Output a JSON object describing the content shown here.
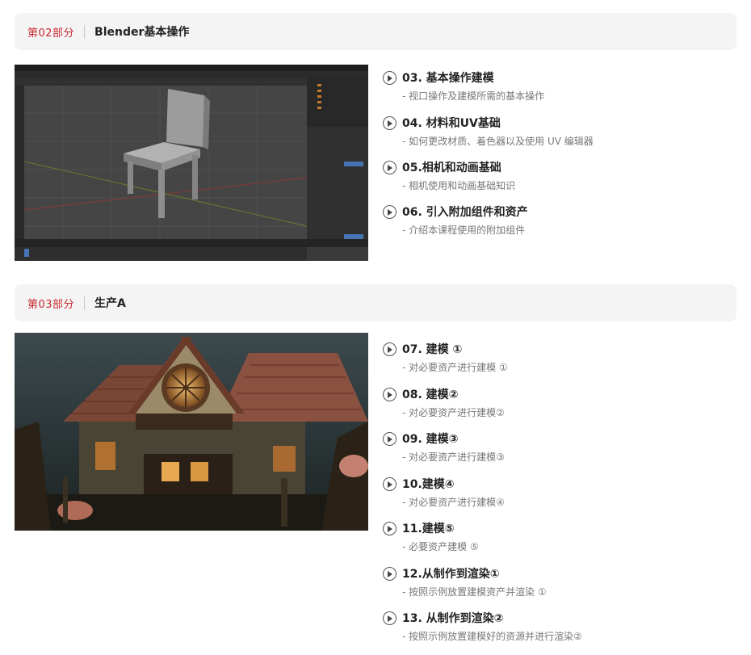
{
  "sections": [
    {
      "part": "第02部分",
      "title": "Blender基本操作",
      "lessons": [
        {
          "title": "03. 基本操作建模",
          "sub": "- 视口操作及建模所需的基本操作"
        },
        {
          "title": "04. 材料和UV基础",
          "sub": "- 如何更改材质、着色器以及使用 UV 编辑器"
        },
        {
          "title": "05.相机和动画基础",
          "sub": "- 相机使用和动画基础知识"
        },
        {
          "title": "06. 引入附加组件和资产",
          "sub": "- 介绍本课程使用的附加组件"
        }
      ]
    },
    {
      "part": "第03部分",
      "title": "生产A",
      "lessons": [
        {
          "title": "07. 建模 ①",
          "sub": "- 对必要资产进行建模 ①"
        },
        {
          "title": "08. 建模②",
          "sub": "- 对必要资产进行建模②"
        },
        {
          "title": "09. 建模③",
          "sub": "- 对必要资产进行建模③"
        },
        {
          "title": "10.建模④",
          "sub": "- 对必要资产进行建模④"
        },
        {
          "title": "11.建模⑤",
          "sub": "- 必要资产建模 ⑤"
        },
        {
          "title": "12.从制作到渲染①",
          "sub": "- 按照示例放置建模资产并渲染 ①"
        },
        {
          "title": "13. 从制作到渲染②",
          "sub": "- 按照示例放置建模好的资源并进行渲染②"
        }
      ]
    }
  ],
  "colors": {
    "accent": "#c8272f",
    "header_bg": "#f4f4f4"
  },
  "icons": {
    "lesson": "play-circle-icon"
  }
}
